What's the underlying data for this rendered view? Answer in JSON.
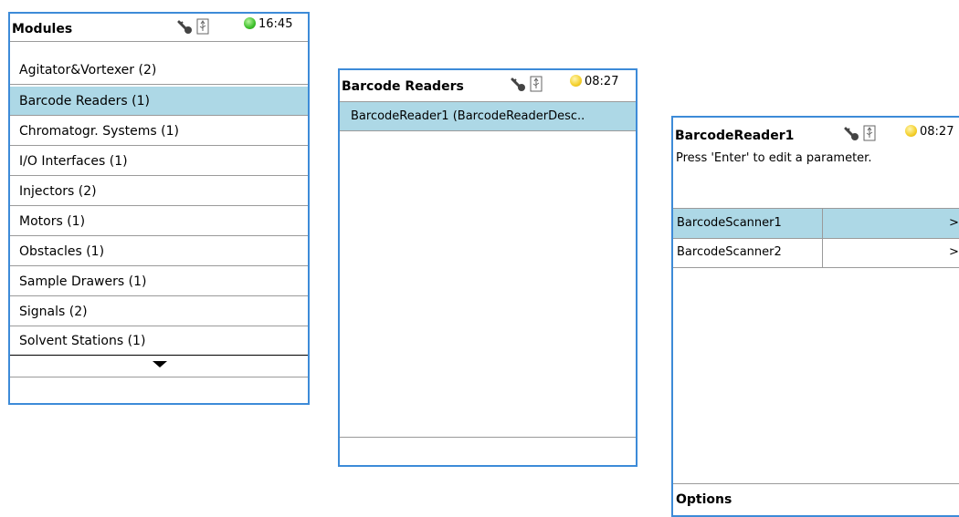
{
  "colors": {
    "panel_border": "#3d8bd8",
    "selection": "#add8e6",
    "status_ok": "#3cc02a",
    "status_warn": "#f4cf2a"
  },
  "modules": {
    "title": "Modules",
    "time": "16:45",
    "status": "green",
    "items": [
      {
        "label": "Agitator&Vortexer (2)",
        "selected": false
      },
      {
        "label": "Barcode Readers (1)",
        "selected": true
      },
      {
        "label": "Chromatogr. Systems (1)",
        "selected": false
      },
      {
        "label": "I/O Interfaces (1)",
        "selected": false
      },
      {
        "label": "Injectors (2)",
        "selected": false
      },
      {
        "label": "Motors (1)",
        "selected": false
      },
      {
        "label": "Obstacles (1)",
        "selected": false
      },
      {
        "label": "Sample Drawers (1)",
        "selected": false
      },
      {
        "label": "Signals (2)",
        "selected": false
      },
      {
        "label": "Solvent Stations (1)",
        "selected": false
      }
    ],
    "scroll_icon": "triangle-down-icon"
  },
  "barcode_readers": {
    "title": "Barcode Readers",
    "time": "08:27",
    "status": "yellow",
    "items": [
      {
        "label": "BarcodeReader1 (BarcodeReaderDesc..",
        "selected": true
      }
    ]
  },
  "barcode_reader1": {
    "title": "BarcodeReader1",
    "time": "08:27",
    "status": "yellow",
    "hint": "Press 'Enter' to edit a parameter.",
    "params": [
      {
        "name": "BarcodeScanner1",
        "value": ">",
        "selected": true
      },
      {
        "name": "BarcodeScanner2",
        "value": ">",
        "selected": false
      }
    ],
    "footer": "Options"
  },
  "icons": [
    "key-icon",
    "usb-icon",
    "status-led-icon"
  ]
}
